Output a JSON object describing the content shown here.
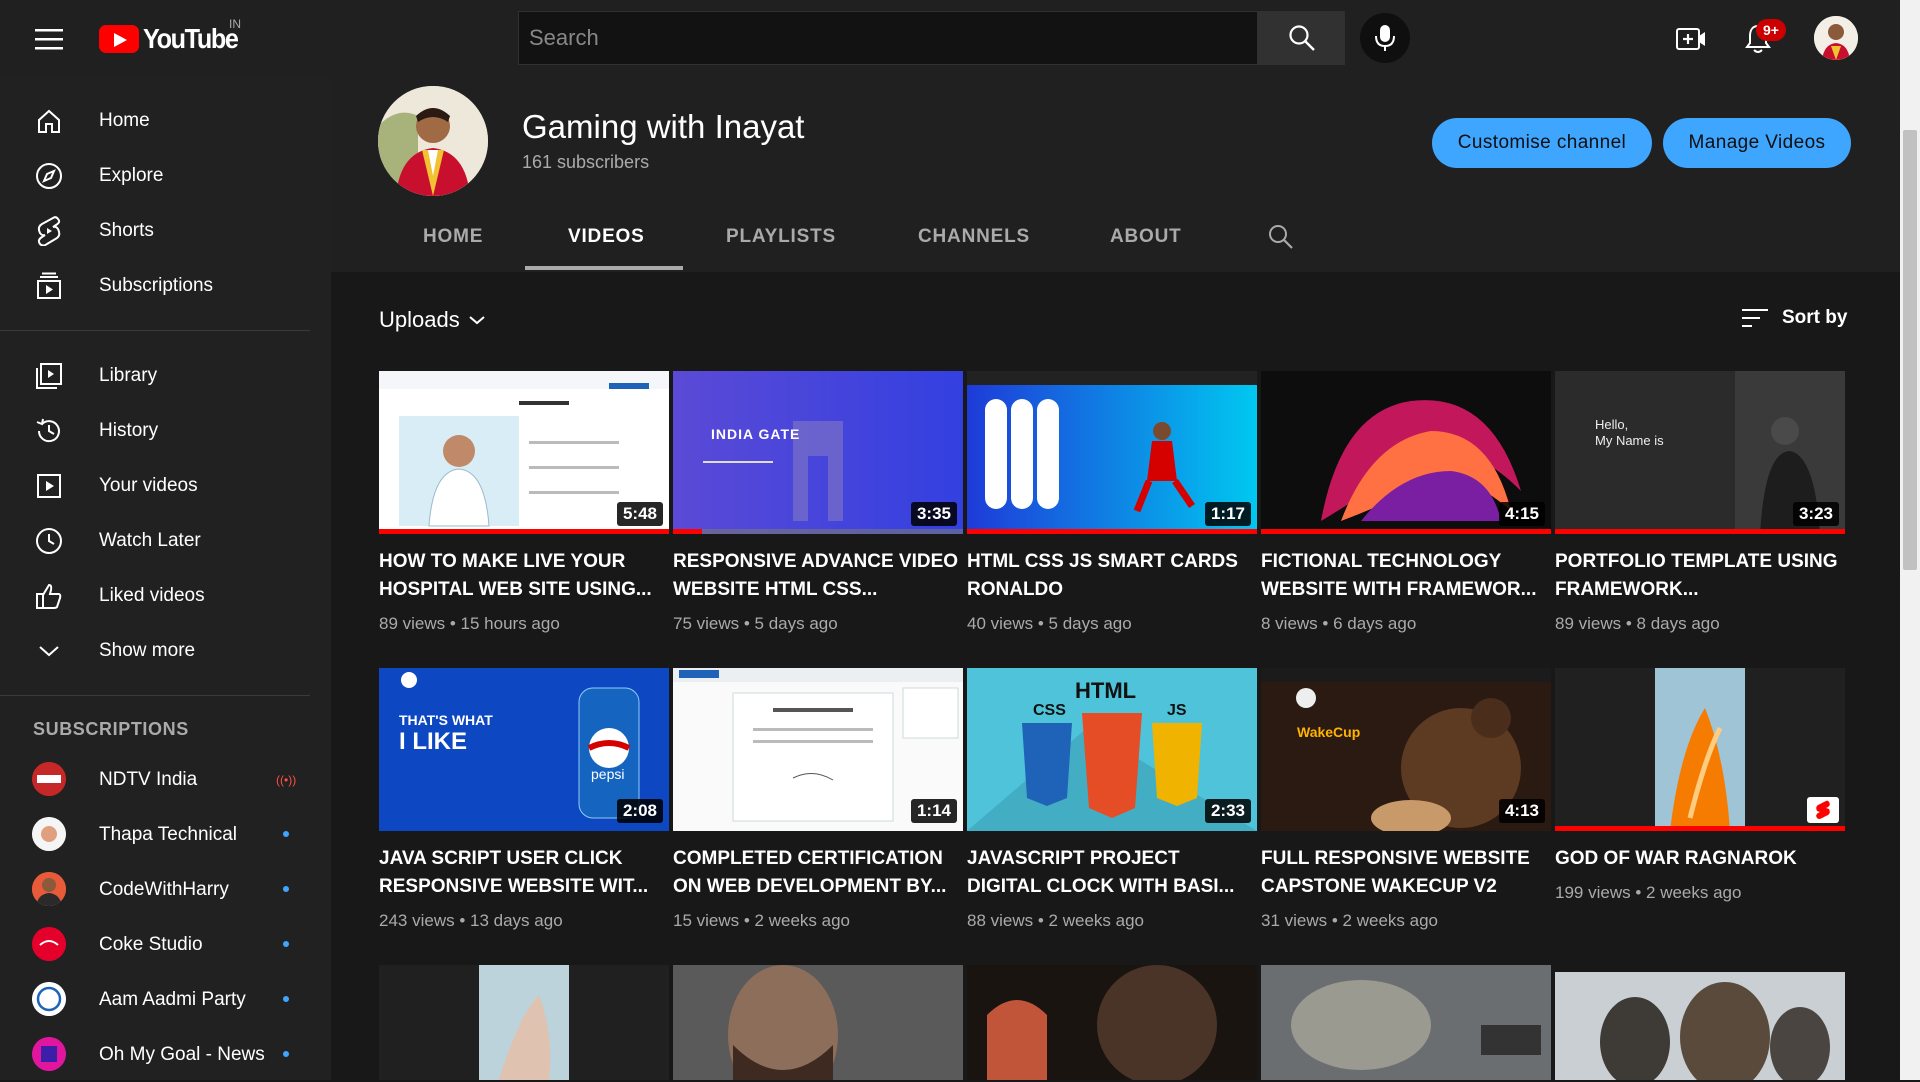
{
  "masthead": {
    "logo_text": "YouTube",
    "region": "IN",
    "search_placeholder": "Search",
    "notification_count": "9+"
  },
  "sidebar": {
    "main": [
      {
        "label": "Home",
        "icon": "home-icon"
      },
      {
        "label": "Explore",
        "icon": "compass-icon"
      },
      {
        "label": "Shorts",
        "icon": "shorts-icon"
      },
      {
        "label": "Subscriptions",
        "icon": "subscriptions-icon"
      }
    ],
    "library": [
      {
        "label": "Library",
        "icon": "library-icon"
      },
      {
        "label": "History",
        "icon": "history-icon"
      },
      {
        "label": "Your videos",
        "icon": "your-videos-icon"
      },
      {
        "label": "Watch Later",
        "icon": "clock-icon"
      },
      {
        "label": "Liked videos",
        "icon": "thumbs-up-icon"
      },
      {
        "label": "Show more",
        "icon": "chevron-down-icon"
      }
    ],
    "subscriptions_heading": "SUBSCRIPTIONS",
    "subscriptions": [
      {
        "name": "NDTV India",
        "status": "live",
        "color": "#d32f2f"
      },
      {
        "name": "Thapa Technical",
        "status": "new",
        "color": "#f5f5f5"
      },
      {
        "name": "CodeWithHarry",
        "status": "new",
        "color": "#e85b3a"
      },
      {
        "name": "Coke Studio",
        "status": "new",
        "color": "#e4002b"
      },
      {
        "name": "Aam Aadmi Party",
        "status": "new",
        "color": "#ffffff"
      },
      {
        "name": "Oh My Goal - News",
        "status": "new",
        "color": "#e0169f"
      }
    ]
  },
  "channel": {
    "name": "Gaming with Inayat",
    "subscribers": "161 subscribers",
    "customise_label": "Customise channel",
    "manage_label": "Manage Videos",
    "tabs": [
      "HOME",
      "VIDEOS",
      "PLAYLISTS",
      "CHANNELS",
      "ABOUT"
    ],
    "active_tab": "VIDEOS"
  },
  "uploads": {
    "label": "Uploads",
    "sort_label": "Sort by"
  },
  "videos": [
    {
      "title": "HOW TO MAKE LIVE YOUR HOSPITAL WEB SITE USING...",
      "views": "89 views",
      "age": "15 hours ago",
      "duration": "5:48",
      "watched": 1.0
    },
    {
      "title": "RESPONSIVE ADVANCE VIDEO WEBSITE HTML CSS...",
      "views": "75 views",
      "age": "5 days ago",
      "duration": "3:35",
      "watched": 0.1
    },
    {
      "title": "HTML CSS JS SMART CARDS RONALDO",
      "views": "40 views",
      "age": "5 days ago",
      "duration": "1:17",
      "watched": 1.0
    },
    {
      "title": "FICTIONAL TECHNOLOGY WEBSITE WITH FRAMEWOR...",
      "views": "8 views",
      "age": "6 days ago",
      "duration": "4:15",
      "watched": 1.0
    },
    {
      "title": "PORTFOLIO TEMPLATE USING FRAMEWORK...",
      "views": "89 views",
      "age": "8 days ago",
      "duration": "3:23",
      "watched": 1.0
    },
    {
      "title": "JAVA SCRIPT USER CLICK RESPONSIVE WEBSITE WIT...",
      "views": "243 views",
      "age": "13 days ago",
      "duration": "2:08",
      "watched": 0.0
    },
    {
      "title": "COMPLETED CERTIFICATION ON WEB DEVELOPMENT BY...",
      "views": "15 views",
      "age": "2 weeks ago",
      "duration": "1:14",
      "watched": 0.0
    },
    {
      "title": "JAVASCRIPT PROJECT DIGITAL CLOCK WITH BASI...",
      "views": "88 views",
      "age": "2 weeks ago",
      "duration": "2:33",
      "watched": 0.0
    },
    {
      "title": "FULL RESPONSIVE WEBSITE CAPSTONE WAKECUP V2",
      "views": "31 views",
      "age": "2 weeks ago",
      "duration": "4:13",
      "watched": 0.0
    },
    {
      "title": "GOD OF WAR RAGNAROK",
      "views": "199 views",
      "age": "2 weeks ago",
      "duration": "",
      "watched": 1.0,
      "short": true
    }
  ],
  "thumb_text": {
    "t2": "INDIA GATE",
    "t5a": "Hello,",
    "t5b": "My Name is",
    "t6a": "THAT'S WHAT",
    "t6b": "I LIKE",
    "t6c": "pepsi",
    "t8a": "HTML",
    "t8b": "CSS",
    "t8c": "JS",
    "t9": "WakeCup"
  }
}
